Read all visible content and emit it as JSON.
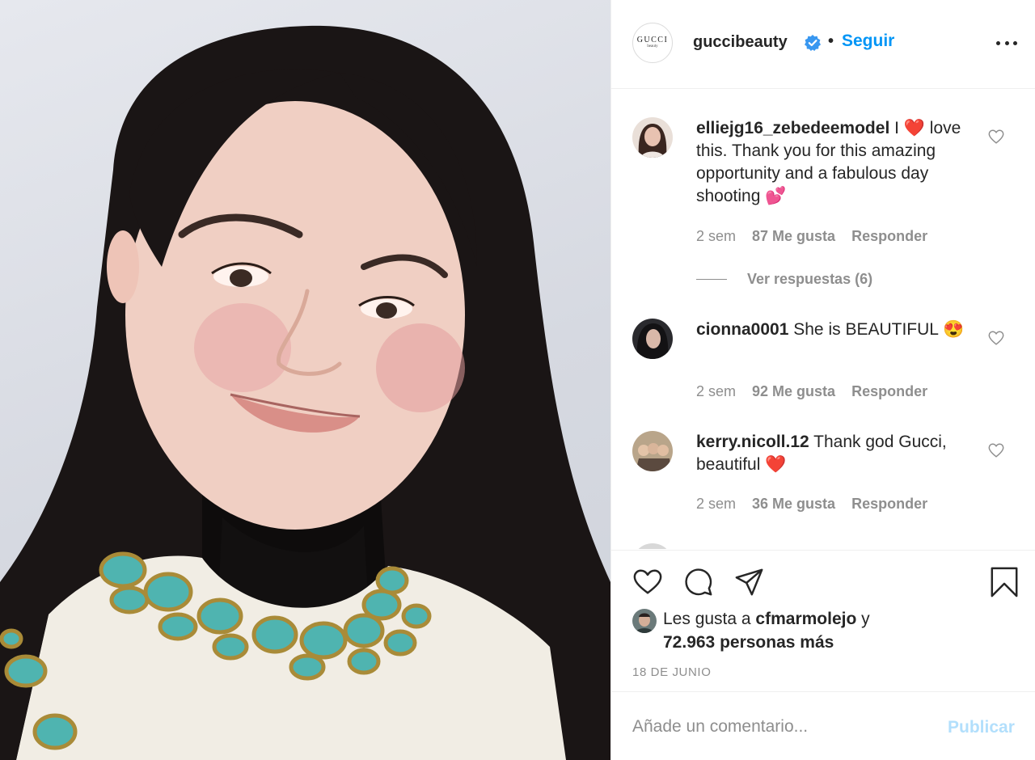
{
  "post": {
    "image_alt": "photo-portrait",
    "author": {
      "avatar_wordmark": "GUCCI",
      "avatar_subtext": "beauty",
      "username": "guccibeauty",
      "separator": "•",
      "follow_label": "Seguir",
      "verified_icon": "verified-badge-icon",
      "more_icon": "more-options-icon"
    },
    "comments": [
      {
        "username": "elliejg16_zebedeemodel",
        "text": "I ❤️ love this. Thank you for this amazing opportunity and a fabulous day shooting 💕",
        "time": "2 sem",
        "likes": "87 Me gusta",
        "reply_label": "Responder",
        "view_replies": "Ver respuestas (6)"
      },
      {
        "username": "cionna0001",
        "text": "She is BEAUTIFUL 😍",
        "time": "2 sem",
        "likes": "92 Me gusta",
        "reply_label": "Responder"
      },
      {
        "username": "kerry.nicoll.12",
        "text": "Thank god Gucci, beautiful ❤️",
        "time": "2 sem",
        "likes": "36 Me gusta",
        "reply_label": "Responder"
      }
    ],
    "actions": {
      "like_icon": "heart-icon",
      "comment_icon": "comment-icon",
      "share_icon": "share-icon",
      "save_icon": "bookmark-icon"
    },
    "likes_summary": {
      "prefix": "Les gusta a ",
      "user": "cfmarmolejo",
      "connector": " y",
      "others": "72.963 personas más"
    },
    "date": "18 DE JUNIO",
    "add_comment": {
      "placeholder": "Añade un comentario...",
      "publish_label": "Publicar"
    }
  },
  "colors": {
    "link_blue": "#0095f6",
    "publish_disabled": "#b2dffc",
    "muted_text": "#8e8e8e",
    "primary_text": "#262626",
    "border": "#efefef",
    "verified_blue": "#3897f0"
  }
}
